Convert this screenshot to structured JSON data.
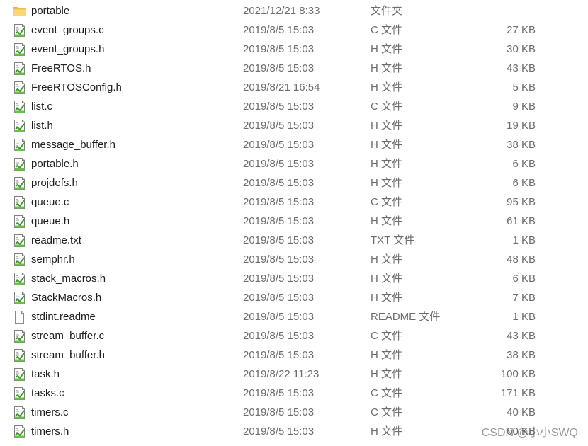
{
  "files": [
    {
      "name": "portable",
      "date": "2021/12/21 8:33",
      "type": "文件夹",
      "size": "",
      "icon": "folder-icon"
    },
    {
      "name": "event_groups.c",
      "date": "2019/8/5 15:03",
      "type": "C 文件",
      "size": "27 KB",
      "icon": "code-file-icon"
    },
    {
      "name": "event_groups.h",
      "date": "2019/8/5 15:03",
      "type": "H 文件",
      "size": "30 KB",
      "icon": "code-file-icon"
    },
    {
      "name": "FreeRTOS.h",
      "date": "2019/8/5 15:03",
      "type": "H 文件",
      "size": "43 KB",
      "icon": "code-file-icon"
    },
    {
      "name": "FreeRTOSConfig.h",
      "date": "2019/8/21 16:54",
      "type": "H 文件",
      "size": "5 KB",
      "icon": "code-file-icon"
    },
    {
      "name": "list.c",
      "date": "2019/8/5 15:03",
      "type": "C 文件",
      "size": "9 KB",
      "icon": "code-file-icon"
    },
    {
      "name": "list.h",
      "date": "2019/8/5 15:03",
      "type": "H 文件",
      "size": "19 KB",
      "icon": "code-file-icon"
    },
    {
      "name": "message_buffer.h",
      "date": "2019/8/5 15:03",
      "type": "H 文件",
      "size": "38 KB",
      "icon": "code-file-icon"
    },
    {
      "name": "portable.h",
      "date": "2019/8/5 15:03",
      "type": "H 文件",
      "size": "6 KB",
      "icon": "code-file-icon"
    },
    {
      "name": "projdefs.h",
      "date": "2019/8/5 15:03",
      "type": "H 文件",
      "size": "6 KB",
      "icon": "code-file-icon"
    },
    {
      "name": "queue.c",
      "date": "2019/8/5 15:03",
      "type": "C 文件",
      "size": "95 KB",
      "icon": "code-file-icon"
    },
    {
      "name": "queue.h",
      "date": "2019/8/5 15:03",
      "type": "H 文件",
      "size": "61 KB",
      "icon": "code-file-icon"
    },
    {
      "name": "readme.txt",
      "date": "2019/8/5 15:03",
      "type": "TXT 文件",
      "size": "1 KB",
      "icon": "code-file-icon"
    },
    {
      "name": "semphr.h",
      "date": "2019/8/5 15:03",
      "type": "H 文件",
      "size": "48 KB",
      "icon": "code-file-icon"
    },
    {
      "name": "stack_macros.h",
      "date": "2019/8/5 15:03",
      "type": "H 文件",
      "size": "6 KB",
      "icon": "code-file-icon"
    },
    {
      "name": "StackMacros.h",
      "date": "2019/8/5 15:03",
      "type": "H 文件",
      "size": "7 KB",
      "icon": "code-file-icon"
    },
    {
      "name": "stdint.readme",
      "date": "2019/8/5 15:03",
      "type": "README 文件",
      "size": "1 KB",
      "icon": "blank-file-icon"
    },
    {
      "name": "stream_buffer.c",
      "date": "2019/8/5 15:03",
      "type": "C 文件",
      "size": "43 KB",
      "icon": "code-file-icon"
    },
    {
      "name": "stream_buffer.h",
      "date": "2019/8/5 15:03",
      "type": "H 文件",
      "size": "38 KB",
      "icon": "code-file-icon"
    },
    {
      "name": "task.h",
      "date": "2019/8/22 11:23",
      "type": "H 文件",
      "size": "100 KB",
      "icon": "code-file-icon"
    },
    {
      "name": "tasks.c",
      "date": "2019/8/5 15:03",
      "type": "C 文件",
      "size": "171 KB",
      "icon": "code-file-icon"
    },
    {
      "name": "timers.c",
      "date": "2019/8/5 15:03",
      "type": "C 文件",
      "size": "40 KB",
      "icon": "code-file-icon"
    },
    {
      "name": "timers.h",
      "date": "2019/8/5 15:03",
      "type": "H 文件",
      "size": "60 KB",
      "icon": "code-file-icon"
    }
  ],
  "watermark": "CSDN @小小SWQ"
}
